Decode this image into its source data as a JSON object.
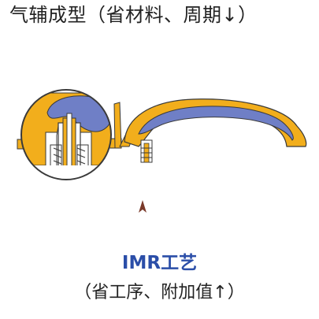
{
  "header": {
    "title": "气辅成型（省材料、周期↓）"
  },
  "caption": {
    "process_name": "IMR工艺",
    "benefit": "（省工序、附加值↑）"
  },
  "colors": {
    "mold_yellow": "#F2AE1C",
    "plastic_blue": "#6F7FC6",
    "outline": "#3a3a3a",
    "accent_text": "#2b4ea8"
  }
}
